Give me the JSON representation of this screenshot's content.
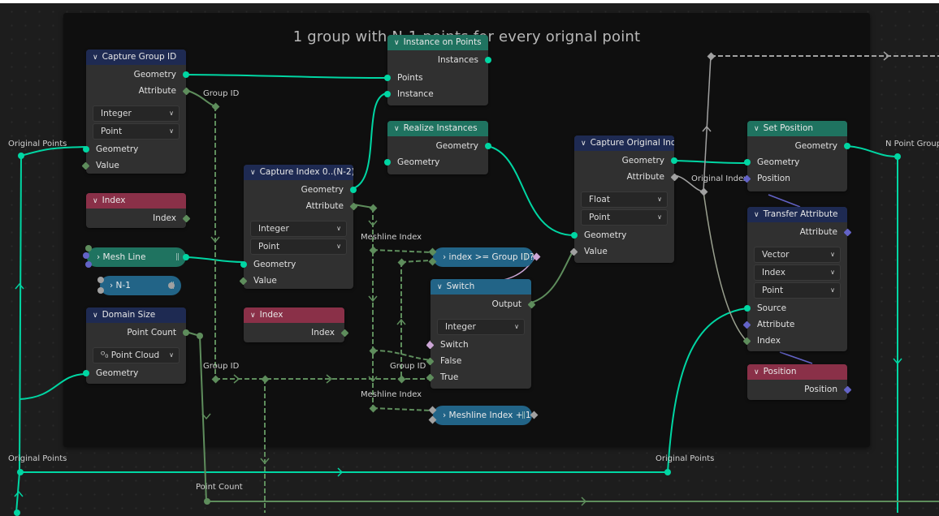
{
  "frame": {
    "title": "1 group with N-1 points for every orignal point"
  },
  "nodes": {
    "capture_group_id": {
      "title": "Capture Group ID",
      "outputs": [
        "Geometry",
        "Attribute"
      ],
      "data_type": "Integer",
      "domain": "Point",
      "inputs": [
        "Geometry",
        "Value"
      ]
    },
    "index1": {
      "title": "Index",
      "output": "Index"
    },
    "mesh_line": {
      "title": "Mesh Line"
    },
    "n_minus_1": {
      "title": "N-1"
    },
    "domain_size": {
      "title": "Domain Size",
      "output": "Point Count",
      "component": "Point Cloud",
      "input": "Geometry"
    },
    "capture_index": {
      "title": "Capture  Index 0..(N-2)",
      "outputs": [
        "Geometry",
        "Attribute"
      ],
      "data_type": "Integer",
      "domain": "Point",
      "inputs": [
        "Geometry",
        "Value"
      ]
    },
    "index2": {
      "title": "Index",
      "output": "Index"
    },
    "instance_on_points": {
      "title": "Instance on Points",
      "output": "Instances",
      "inputs": [
        "Points",
        "Instance"
      ]
    },
    "realize_instances": {
      "title": "Realize Instances",
      "output": "Geometry",
      "input": "Geometry"
    },
    "compare": {
      "title": "index >= Group ID?"
    },
    "switch": {
      "title": "Switch",
      "output": "Output",
      "data_type": "Integer",
      "inputs": [
        "Switch",
        "False",
        "True"
      ]
    },
    "add": {
      "title": "Meshline Index + 1"
    },
    "capture_original_index": {
      "title": "Capture Original Index",
      "outputs": [
        "Geometry",
        "Attribute"
      ],
      "data_type": "Float",
      "domain": "Point",
      "inputs": [
        "Geometry",
        "Value"
      ]
    },
    "set_position": {
      "title": "Set Position",
      "output": "Geometry",
      "inputs": [
        "Geometry",
        "Position"
      ]
    },
    "transfer_attribute": {
      "title": "Transfer Attribute",
      "output": "Attribute",
      "data_type": "Vector",
      "mapping": "Index",
      "domain": "Point",
      "inputs": [
        "Source",
        "Attribute",
        "Index"
      ]
    },
    "position": {
      "title": "Position",
      "output": "Position"
    }
  },
  "reroutes": {
    "original_points_top": "Original Points",
    "group_id_top": "Group ID",
    "meshline_index_1": "Meshline Index",
    "group_id_bottom_left": "Group ID",
    "group_id_bottom_right": "Group ID",
    "meshline_index_2": "Meshline Index",
    "original_index": "Original Index",
    "n_point_groups": "N Point Groups",
    "original_points_bottom": "Original Points",
    "original_points_right": "Original Points",
    "point_count": "Point Count"
  },
  "colors": {
    "geometry_socket": "#00d6a3",
    "integer_socket": "#5e8d5c",
    "vector_socket": "#6363c7",
    "boolean_socket": "#cca6d6",
    "float_socket": "#a1a1a1",
    "geometry_header": "#1e2a52",
    "input_header": "#8a3048",
    "green_header": "#1f7360",
    "utility_header": "#226487"
  }
}
